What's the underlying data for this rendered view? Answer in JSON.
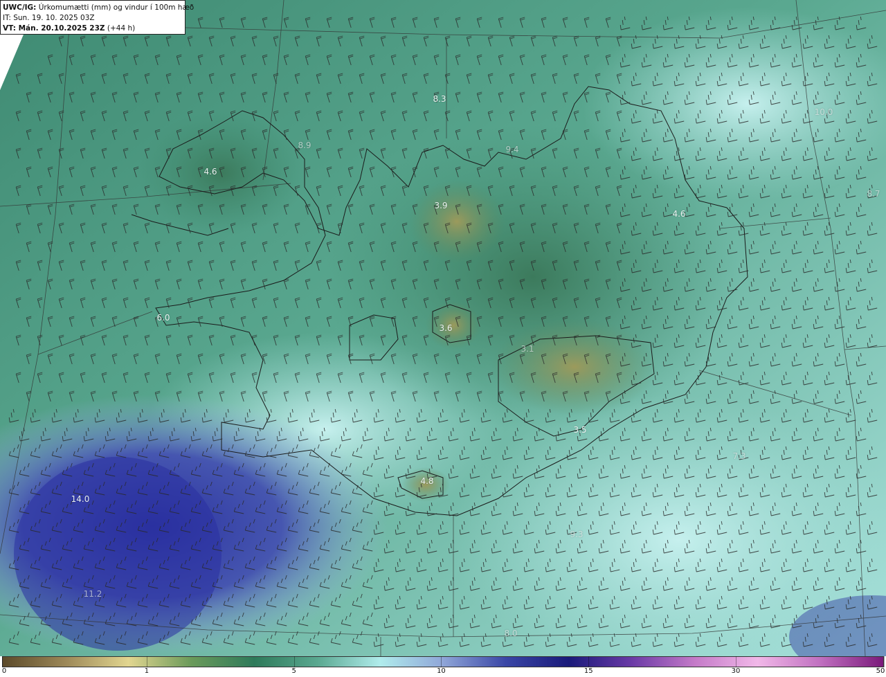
{
  "header": {
    "model": "UWC/IG:",
    "title": "Úrkomumætti (mm) og vindur í 100m hæð",
    "initial_time": "IT: Sun. 19. 10. 2025 03Z",
    "valid_label": "VT: Mán. 20.10.2025 23Z",
    "lead": "(+44 h)"
  },
  "map": {
    "field": "precipitable water",
    "units": "mm",
    "wind_level": "100m",
    "overlay": "wind barbs",
    "value_labels": [
      "8.3",
      "8.9",
      "4.6",
      "9.4",
      "3.9",
      "4.6",
      "6.0",
      "3.6",
      "3.1",
      "3.5",
      "4.8",
      "7.3",
      "14.0",
      "11.2",
      "9.3",
      "8.0",
      "10.0",
      "8.7"
    ],
    "colors": {
      "dry_land": "#9a9a5a",
      "mid_green": "#3f8a6e",
      "light_cyan": "#a8e2de",
      "blue": "#4b58ad",
      "deep_blue": "#222a8a"
    }
  },
  "colorbar": {
    "ticks": [
      "0",
      "1",
      "5",
      "10",
      "15",
      "30",
      "50"
    ],
    "tick_fractions": [
      0.0,
      0.164,
      0.331,
      0.498,
      0.665,
      0.832,
      1.0
    ],
    "stops": [
      "#5c4a2a",
      "#9c8858",
      "#e2d690",
      "#6a9a5a",
      "#2e7a5a",
      "#5aa890",
      "#b0ecec",
      "#8fa6d8",
      "#3a46a6",
      "#1a1a7a",
      "#6a3aa6",
      "#c47ac8",
      "#f1b8e8",
      "#c070c0",
      "#7a1a7a"
    ]
  }
}
